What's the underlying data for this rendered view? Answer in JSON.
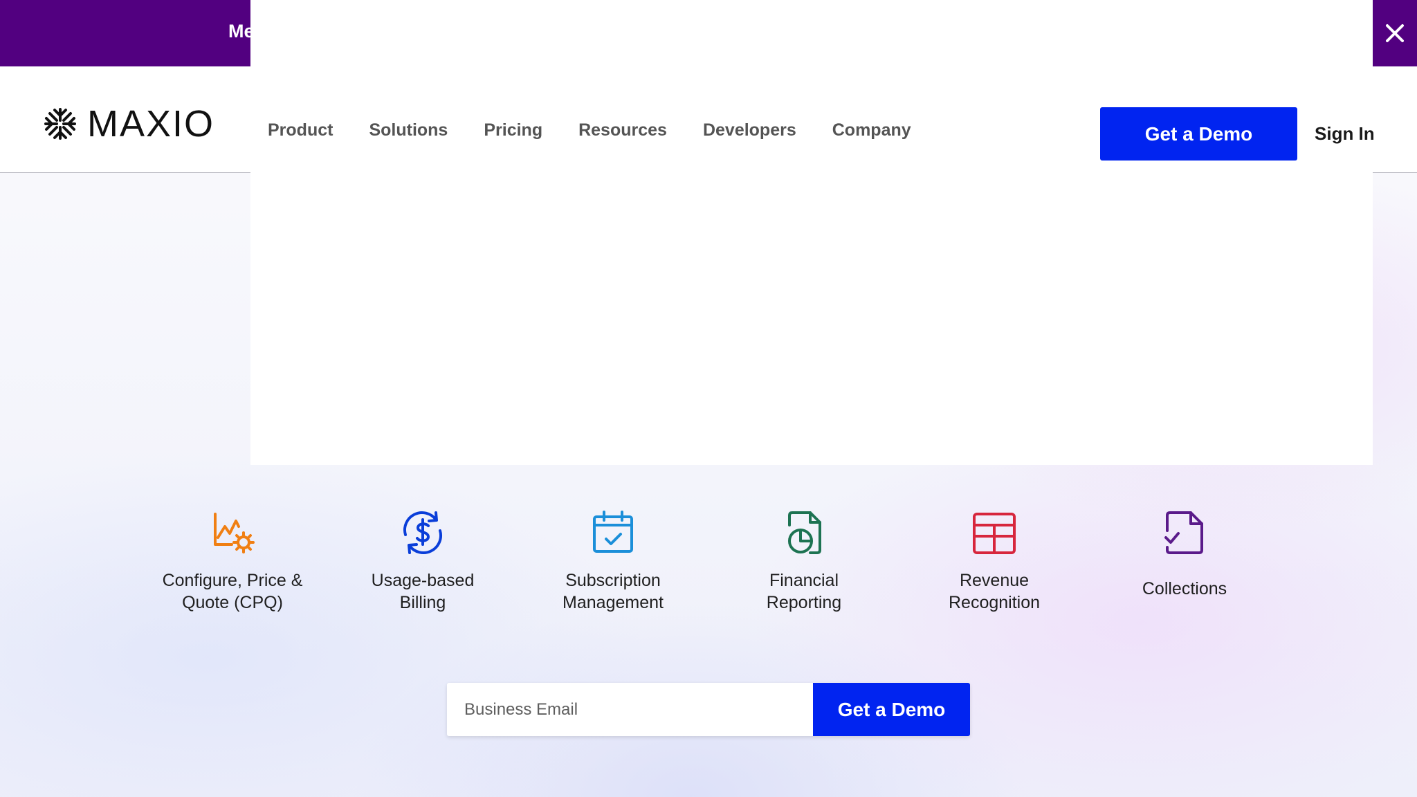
{
  "promo": {
    "text": "Me",
    "close_icon": "close-icon"
  },
  "header": {
    "logo_text": "MAXIO",
    "logo_icon": "asterisk-logo-icon",
    "nav": [
      {
        "label": "Product"
      },
      {
        "label": "Solutions"
      },
      {
        "label": "Pricing"
      },
      {
        "label": "Resources"
      },
      {
        "label": "Developers"
      },
      {
        "label": "Company"
      }
    ],
    "demo_button": "Get a Demo",
    "sign_in": "Sign In"
  },
  "features": [
    {
      "label": "Configure, Price &\nQuote (CPQ)",
      "icon": "chart-gear-icon",
      "color": "#f07f13"
    },
    {
      "label": "Usage-based\nBilling",
      "icon": "dollar-cycle-icon",
      "color": "#0a3ed9"
    },
    {
      "label": "Subscription\nManagement",
      "icon": "calendar-check-icon",
      "color": "#1b8fd9"
    },
    {
      "label": "Financial\nReporting",
      "icon": "document-pie-icon",
      "color": "#1d7352"
    },
    {
      "label": "Revenue\nRecognition",
      "icon": "table-icon",
      "color": "#d7263d"
    },
    {
      "label": "Collections",
      "icon": "document-check-icon",
      "color": "#5a1a8a"
    }
  ],
  "email_form": {
    "placeholder": "Business Email",
    "button": "Get a Demo"
  },
  "colors": {
    "promo_bg": "#520080",
    "primary_button": "#0124f0"
  }
}
